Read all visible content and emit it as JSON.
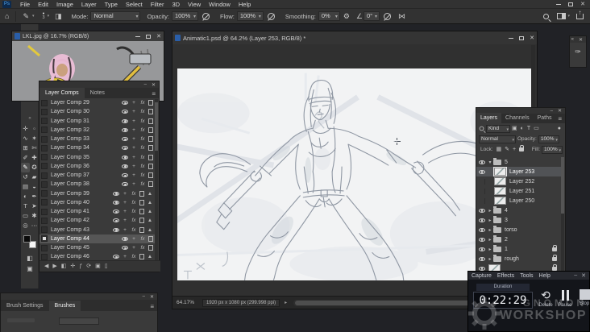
{
  "app": {
    "logo": "Ps"
  },
  "menu_bar": {
    "items": [
      "File",
      "Edit",
      "Image",
      "Layer",
      "Type",
      "Select",
      "Filter",
      "3D",
      "View",
      "Window",
      "Help"
    ]
  },
  "options_bar": {
    "brush_size": "3",
    "mode_label": "Mode:",
    "mode_value": "Normal",
    "opacity_label": "Opacity:",
    "opacity_value": "100%",
    "flow_label": "Flow:",
    "flow_value": "100%",
    "smoothing_label": "Smoothing:",
    "smoothing_value": "0%",
    "angle_value": "0°"
  },
  "toolbar": {
    "selected_tool": "brush",
    "tools": [
      [
        "move",
        "marquee"
      ],
      [
        "lasso",
        "wand"
      ],
      [
        "crop",
        "slice"
      ],
      [
        "eyedropper",
        "healing"
      ],
      [
        "brush",
        "stamp"
      ],
      [
        "history-brush",
        "eraser"
      ],
      [
        "gradient",
        "blur"
      ],
      [
        "dodge",
        "pen"
      ],
      [
        "type",
        "path-select"
      ],
      [
        "rectangle",
        "hand"
      ],
      [
        "zoom",
        "edit-toolbar"
      ]
    ]
  },
  "lkl_window": {
    "title": "LKL.jpg @ 16.7% (RGB/8)"
  },
  "doc_window": {
    "title": "Animatic1.psd @ 64.2% (Layer 253, RGB/8) *",
    "zoom_level": "64.17%",
    "doc_size": "1920 px x 1080 px (299.998 ppi)"
  },
  "layer_comps": {
    "tabs": [
      "Layer Comps",
      "Notes"
    ],
    "rows": [
      {
        "name": "Layer Comp 29",
        "warning": false,
        "selected": false
      },
      {
        "name": "Layer Comp 30",
        "warning": false,
        "selected": false
      },
      {
        "name": "Layer Comp 31",
        "warning": false,
        "selected": false
      },
      {
        "name": "Layer Comp 32",
        "warning": false,
        "selected": false
      },
      {
        "name": "Layer Comp 33",
        "warning": false,
        "selected": false
      },
      {
        "name": "Layer Comp 34",
        "warning": false,
        "selected": false
      },
      {
        "name": "Layer Comp 35",
        "warning": false,
        "selected": false
      },
      {
        "name": "Layer Comp 36",
        "warning": false,
        "selected": false
      },
      {
        "name": "Layer Comp 37",
        "warning": false,
        "selected": false
      },
      {
        "name": "Layer Comp 38",
        "warning": false,
        "selected": false
      },
      {
        "name": "Layer Comp 39",
        "warning": true,
        "selected": false
      },
      {
        "name": "Layer Comp 40",
        "warning": true,
        "selected": false
      },
      {
        "name": "Layer Comp 41",
        "warning": true,
        "selected": false
      },
      {
        "name": "Layer Comp 42",
        "warning": true,
        "selected": false
      },
      {
        "name": "Layer Comp 43",
        "warning": true,
        "selected": false
      },
      {
        "name": "Layer Comp 44",
        "warning": false,
        "selected": true
      },
      {
        "name": "Layer Comp 45",
        "warning": false,
        "selected": false
      },
      {
        "name": "Layer Comp 46",
        "warning": true,
        "selected": false
      }
    ]
  },
  "layers_panel": {
    "tabs": [
      "Layers",
      "Channels",
      "Paths"
    ],
    "filter_value": "Kind",
    "blend_mode": "Normal",
    "opacity_label": "Opacity:",
    "opacity_value": "100%",
    "lock_label": "Lock:",
    "fill_label": "Fill:",
    "fill_value": "100%",
    "rows": [
      {
        "kind": "group",
        "name": "5",
        "eye": true,
        "expanded": true,
        "selected": false,
        "locked": false
      },
      {
        "kind": "layer",
        "name": "Layer 253",
        "eye": true,
        "selected": true,
        "locked": false
      },
      {
        "kind": "layer",
        "name": "Layer 252",
        "eye": false,
        "selected": false,
        "locked": false
      },
      {
        "kind": "layer",
        "name": "Layer 251",
        "eye": false,
        "selected": false,
        "locked": false
      },
      {
        "kind": "layer",
        "name": "Layer 250",
        "eye": false,
        "selected": false,
        "locked": false
      },
      {
        "kind": "group",
        "name": "4",
        "eye": true,
        "expanded": false,
        "selected": false,
        "locked": false
      },
      {
        "kind": "group",
        "name": "3",
        "eye": true,
        "expanded": false,
        "selected": false,
        "locked": false
      },
      {
        "kind": "group",
        "name": "torso",
        "eye": true,
        "expanded": false,
        "selected": false,
        "locked": false
      },
      {
        "kind": "group",
        "name": "2",
        "eye": true,
        "expanded": false,
        "selected": false,
        "locked": false
      },
      {
        "kind": "group",
        "name": "1",
        "eye": true,
        "expanded": false,
        "selected": false,
        "locked": true
      },
      {
        "kind": "group",
        "name": "rough",
        "eye": true,
        "expanded": false,
        "selected": false,
        "locked": true
      },
      {
        "kind": "layer",
        "name": "",
        "eye": true,
        "selected": false,
        "locked": true,
        "root": true
      }
    ]
  },
  "capture_panel": {
    "menu": [
      "Capture",
      "Effects",
      "Tools",
      "Help"
    ],
    "duration_label": "Duration",
    "time": "0:22:29",
    "buttons": [
      {
        "label": "Delete"
      },
      {
        "label": "Pause"
      },
      {
        "label": "Stop"
      }
    ]
  },
  "brush_panel": {
    "tabs": [
      "Brush Settings",
      "Brushes"
    ]
  },
  "watermark": {
    "line1": "GNOMON",
    "line2": "WORKSHOP"
  }
}
